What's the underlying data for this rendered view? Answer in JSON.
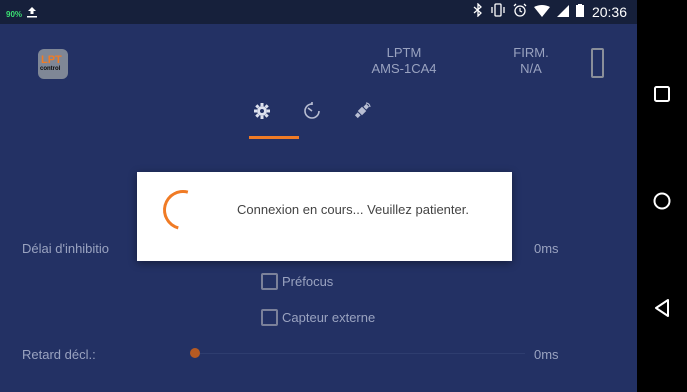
{
  "statusbar": {
    "battery_percent": "90%",
    "time": "20:36"
  },
  "app": {
    "logo": {
      "line1": "LPT",
      "line2": "control"
    },
    "device": {
      "line1": "LPTM",
      "line2": "AMS-1CA4"
    },
    "firmware": {
      "line1": "FIRM.",
      "line2": "N/A"
    }
  },
  "tabs": [
    {
      "icon": "gear-icon",
      "active": true
    },
    {
      "icon": "timer-icon",
      "active": false
    },
    {
      "icon": "satellite-icon",
      "active": false
    }
  ],
  "settings": {
    "inhibition": {
      "label": "Délai d'inhibitio",
      "value": "0ms"
    },
    "prefocus": {
      "label": "Préfocus",
      "checked": false
    },
    "external_sensor": {
      "label": "Capteur externe",
      "checked": false
    },
    "trigger_delay": {
      "label": "Retard décl.:",
      "value": "0ms"
    }
  },
  "dialog": {
    "message": "Connexion en cours... Veuillez patienter."
  },
  "colors": {
    "accent": "#f07b25",
    "background": "#233164"
  }
}
